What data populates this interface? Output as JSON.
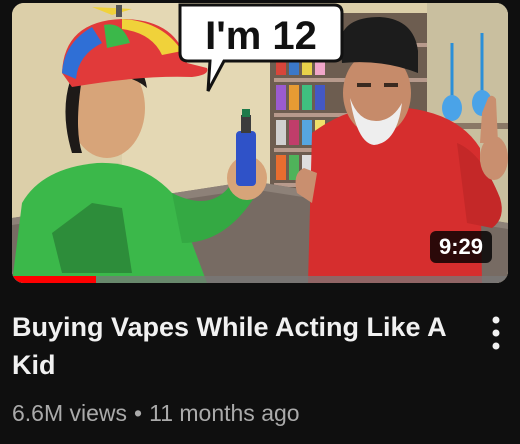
{
  "video": {
    "thumbnail": {
      "caption": "I'm 12",
      "duration": "9:29",
      "watched_fraction": 0.17
    },
    "title": "Buying Vapes While Acting Like A Kid",
    "views": "6.6M views",
    "separator": "•",
    "age": "11 months ago"
  },
  "menu": {
    "icon": "more-vert-icon"
  },
  "colors": {
    "background": "#0f0f0f",
    "title_text": "#f1f1f1",
    "meta_text": "#aaaaaa",
    "progress": "#ff0000"
  }
}
